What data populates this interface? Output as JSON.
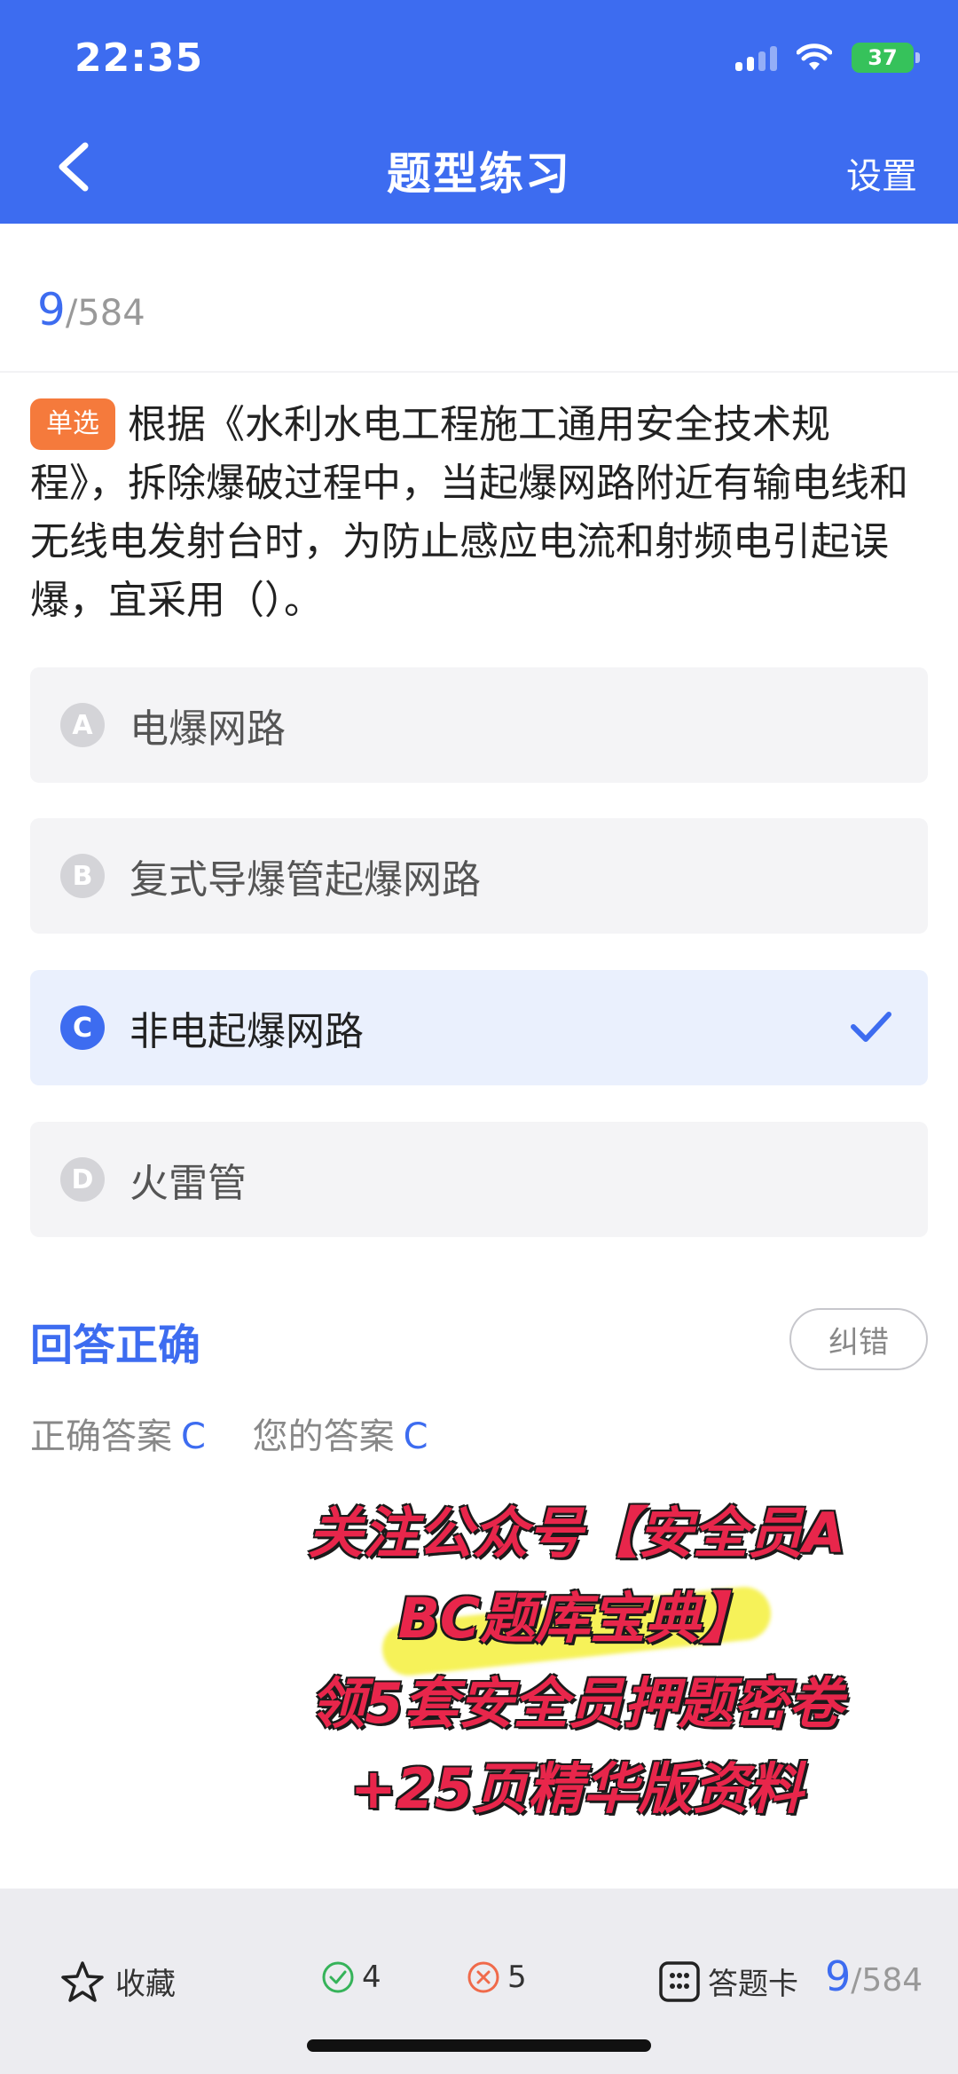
{
  "status_bar": {
    "time": "22:35",
    "battery": "37"
  },
  "nav": {
    "title": "题型练习",
    "right_label": "设置",
    "back_icon": "chevron-left-icon"
  },
  "progress": {
    "current": "9",
    "total": "/584"
  },
  "question": {
    "type_badge": "单选",
    "text": "根据《水利水电工程施工通用安全技术规程》，拆除爆破过程中，当起爆网路附近有输电线和无线电发射台时，为防止感应电流和射频电引起误爆，宜采用（）。"
  },
  "options": [
    {
      "letter": "A",
      "text": "电爆网路",
      "selected": false
    },
    {
      "letter": "B",
      "text": "复式导爆管起爆网路",
      "selected": false
    },
    {
      "letter": "C",
      "text": "非电起爆网路",
      "selected": true
    },
    {
      "letter": "D",
      "text": "火雷管",
      "selected": false
    }
  ],
  "result": {
    "title": "回答正确",
    "fix_label": "纠错",
    "correct_label": "正确答案",
    "correct_value": "C",
    "yours_label": "您的答案",
    "yours_value": "C"
  },
  "promo": {
    "line1": "关注公众号【安全员A",
    "line2": "BC题库宝典】",
    "line3": "领5套安全员押题密卷",
    "line4": "+25页精华版资料"
  },
  "bottom_bar": {
    "favorite_label": "收藏",
    "right_count": "4",
    "wrong_count": "5",
    "card_label": "答题卡",
    "current": "9",
    "total": "/584"
  },
  "colors": {
    "accent": "#3d6cf0",
    "badge": "#f57a3c",
    "correct": "#36b35a",
    "wrong": "#f06a4a",
    "promo": "#e8264b"
  }
}
